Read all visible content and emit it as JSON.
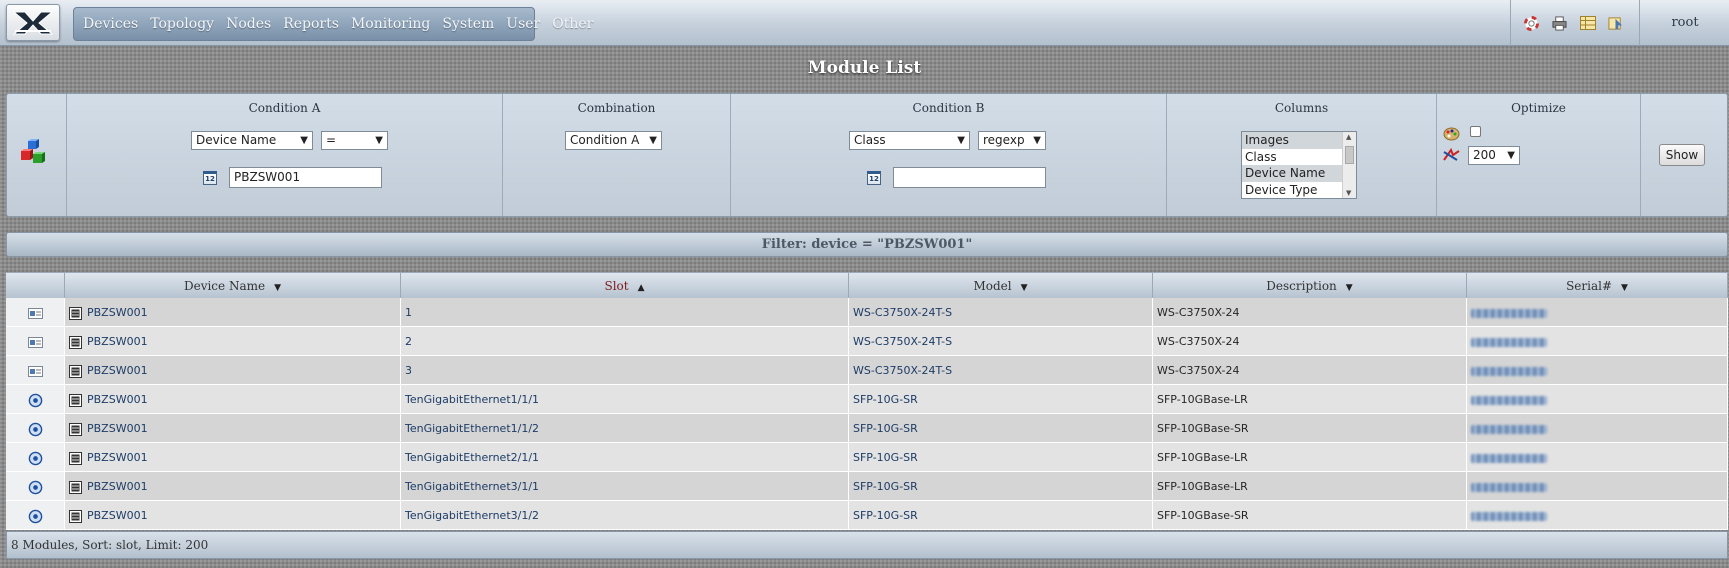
{
  "nav": {
    "items": [
      "Devices",
      "Topology",
      "Nodes",
      "Reports",
      "Monitoring",
      "System",
      "User",
      "Other"
    ],
    "user": "root"
  },
  "tools": [
    "help-icon",
    "print-icon",
    "table-icon",
    "export-icon"
  ],
  "page": {
    "title": "Module List"
  },
  "filter_panel": {
    "condition_a": {
      "title": "Condition A",
      "field": "Device Name",
      "operator": "=",
      "value": "PBZSW001"
    },
    "combination": {
      "title": "Combination",
      "value": "Condition A"
    },
    "condition_b": {
      "title": "Condition B",
      "field": "Class",
      "operator": "regexp",
      "value": ""
    },
    "columns": {
      "title": "Columns",
      "options": [
        "Images",
        "Class",
        "Device Name",
        "Device Type"
      ],
      "selected": [
        "Images",
        "Device Name"
      ]
    },
    "optimize": {
      "title": "Optimize",
      "limit": "200",
      "checked": false
    },
    "show_label": "Show",
    "calendar_label": "12"
  },
  "filter_text": "Filter: device = \"PBZSW001\"",
  "table": {
    "headers": [
      {
        "label": "",
        "sort": ""
      },
      {
        "label": "Device Name",
        "sort": "▼"
      },
      {
        "label": "Slot",
        "sort": "▲"
      },
      {
        "label": "Model",
        "sort": "▼"
      },
      {
        "label": "Description",
        "sort": "▼"
      },
      {
        "label": "Serial#",
        "sort": "▼"
      }
    ],
    "rows": [
      {
        "icon": "module-card-icon",
        "device": "PBZSW001",
        "slot": "1",
        "model": "WS-C3750X-24T-S",
        "description": "WS-C3750X-24",
        "serial": ""
      },
      {
        "icon": "module-card-icon",
        "device": "PBZSW001",
        "slot": "2",
        "model": "WS-C3750X-24T-S",
        "description": "WS-C3750X-24",
        "serial": ""
      },
      {
        "icon": "module-card-icon",
        "device": "PBZSW001",
        "slot": "3",
        "model": "WS-C3750X-24T-S",
        "description": "WS-C3750X-24",
        "serial": ""
      },
      {
        "icon": "port-icon",
        "device": "PBZSW001",
        "slot": "TenGigabitEthernet1/1/1",
        "model": "SFP-10G-SR",
        "description": "SFP-10GBase-LR",
        "serial": ""
      },
      {
        "icon": "port-icon",
        "device": "PBZSW001",
        "slot": "TenGigabitEthernet1/1/2",
        "model": "SFP-10G-SR",
        "description": "SFP-10GBase-SR",
        "serial": ""
      },
      {
        "icon": "port-icon",
        "device": "PBZSW001",
        "slot": "TenGigabitEthernet2/1/1",
        "model": "SFP-10G-SR",
        "description": "SFP-10GBase-LR",
        "serial": ""
      },
      {
        "icon": "port-icon",
        "device": "PBZSW001",
        "slot": "TenGigabitEthernet3/1/1",
        "model": "SFP-10G-SR",
        "description": "SFP-10GBase-LR",
        "serial": ""
      },
      {
        "icon": "port-icon",
        "device": "PBZSW001",
        "slot": "TenGigabitEthernet3/1/2",
        "model": "SFP-10G-SR",
        "description": "SFP-10GBase-SR",
        "serial": ""
      }
    ]
  },
  "footer": "8 Modules, Sort: slot, Limit: 200"
}
